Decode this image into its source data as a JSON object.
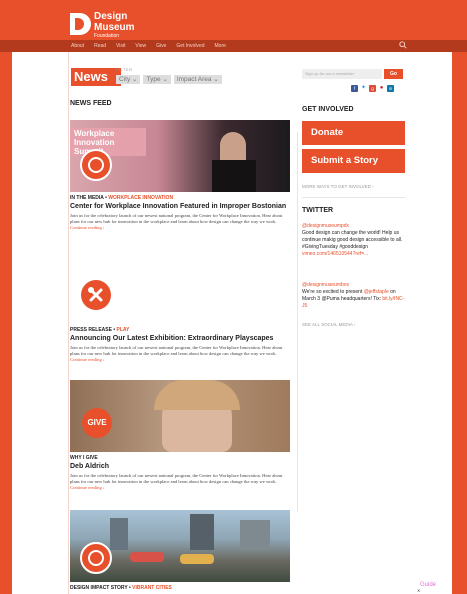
{
  "header": {
    "logo_line1": "Design",
    "logo_line2": "Museum",
    "logo_line3": "Foundation",
    "nav": [
      "About",
      "Read",
      "Visit",
      "View",
      "Give",
      "Get Involved",
      "More"
    ]
  },
  "filters": {
    "news_label": "News",
    "filter_label": "FILTER",
    "items": [
      "City",
      "Type",
      "Impact Area"
    ]
  },
  "feed": {
    "title": "NEWS FEED",
    "stories": [
      {
        "category_main": "IN THE MEDIA",
        "category_sub": "WORKPLACE INNOVATION",
        "title": "Center for Workplace Innovation Featured in Improper Bostonian",
        "image_text": "Workplace Innovation Summit",
        "body": "Join us for the celebratory launch of our newest national program, the Center for Workplace Innovation. Hear about plans for our new hub for innovation in the workplace and learn about how design can change the way we work.",
        "more": "Continue reading ›"
      },
      {
        "category_main": "PRESS RELEASE",
        "category_sub": "PLAY",
        "title": "Announcing Our Latest Exhibition: Extraordinary Playscapes",
        "body": "Join us for the celebratory launch of our newest national program, the Center for Workplace Innovation. Hear about plans for our new hub for innovation in the workplace and learn about how design can change the way we work.",
        "more": "Continue reading ›"
      },
      {
        "category_main": "WHY I GIVE",
        "category_sub": "",
        "title": "Deb Aldrich",
        "badge": "GIVE",
        "body": "Join us for the celebratory launch of our newest national program, the Center for Workplace Innovation. Hear about plans for our new hub for innovation in the workplace and learn about how design can change the way we work.",
        "more": "Continue reading ›"
      },
      {
        "category_main": "DESIGN IMPACT STORY",
        "category_sub": "VIBRANT CITIES"
      }
    ]
  },
  "sidebar": {
    "newsletter_placeholder": "Sign up for our e-newsletter",
    "go_label": "Go",
    "get_involved": "GET INVOLVED",
    "donate": "Donate",
    "submit": "Submit a Story",
    "more_ways": "MORE WAYS TO GET INVOLVED ›",
    "twitter": "TWITTER",
    "tweets": [
      {
        "handle": "@designmuseumpdx",
        "text": "Good design can change the world! Help us continue makig good design accessible to all. #GivingTuesday #gooddesign",
        "link": "vimeo.com/146510544?ref=..."
      },
      {
        "handle": "@designmuseumbos",
        "text_pre": "We're so excited to present",
        "mention": "@jeffstaple",
        "text_post": "on March 3 @Puma headquarters! Tix:",
        "link": "bit.ly/INC-J5"
      }
    ],
    "see_all": "SEE ALL SOCIAL MEDIA ›"
  },
  "overlay": {
    "guide": "Guide"
  },
  "colors": {
    "brand": "#e8502b",
    "nav_dark": "#b33a1d"
  },
  "icons": [
    "search-icon",
    "facebook-icon",
    "twitter-icon",
    "google-plus-icon",
    "pinterest-icon",
    "linkedin-icon"
  ]
}
